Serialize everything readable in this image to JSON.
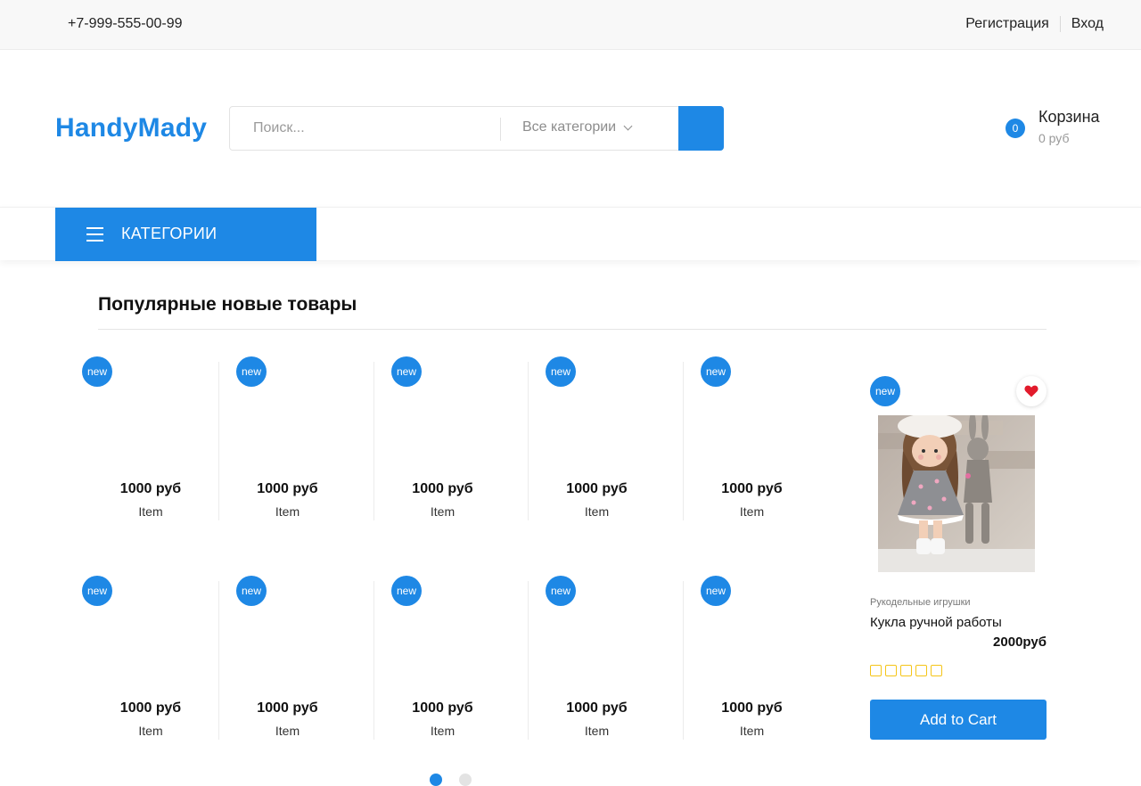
{
  "topbar": {
    "phone": "+7-999-555-00-99",
    "register": "Регистрация",
    "login": "Вход"
  },
  "header": {
    "logo": "HandyMady",
    "search": {
      "placeholder": "Поиск...",
      "category": "Все категории",
      "button_icon": "search-icon"
    },
    "cart": {
      "count": "0",
      "label": "Корзина",
      "amount": "0 руб"
    }
  },
  "nav": {
    "categories_label": "КАТЕГОРИИ",
    "menu_icon": "hamburger-icon"
  },
  "section": {
    "title": "Популярные новые товары"
  },
  "products": [
    {
      "badge": "new",
      "price": "1000 руб",
      "name": "Item"
    },
    {
      "badge": "new",
      "price": "1000 руб",
      "name": "Item"
    },
    {
      "badge": "new",
      "price": "1000 руб",
      "name": "Item"
    },
    {
      "badge": "new",
      "price": "1000 руб",
      "name": "Item"
    },
    {
      "badge": "new",
      "price": "1000 руб",
      "name": "Item"
    },
    {
      "badge": "new",
      "price": "1000 руб",
      "name": "Item"
    },
    {
      "badge": "new",
      "price": "1000 руб",
      "name": "Item"
    },
    {
      "badge": "new",
      "price": "1000 руб",
      "name": "Item"
    },
    {
      "badge": "new",
      "price": "1000 руб",
      "name": "Item"
    },
    {
      "badge": "new",
      "price": "1000 руб",
      "name": "Item"
    }
  ],
  "featured": {
    "badge": "new",
    "category": "Рукодельные игрушки",
    "title": "Кукла ручной работы",
    "price": "2000руб",
    "rating": 0,
    "add_to_cart": "Add to Cart",
    "wishlist_icon": "heart-icon"
  },
  "carousel": {
    "active_page": 1,
    "pages": 2
  },
  "colors": {
    "accent": "#1e88e5",
    "heart": "#e21b2c",
    "star": "#f5c518"
  }
}
